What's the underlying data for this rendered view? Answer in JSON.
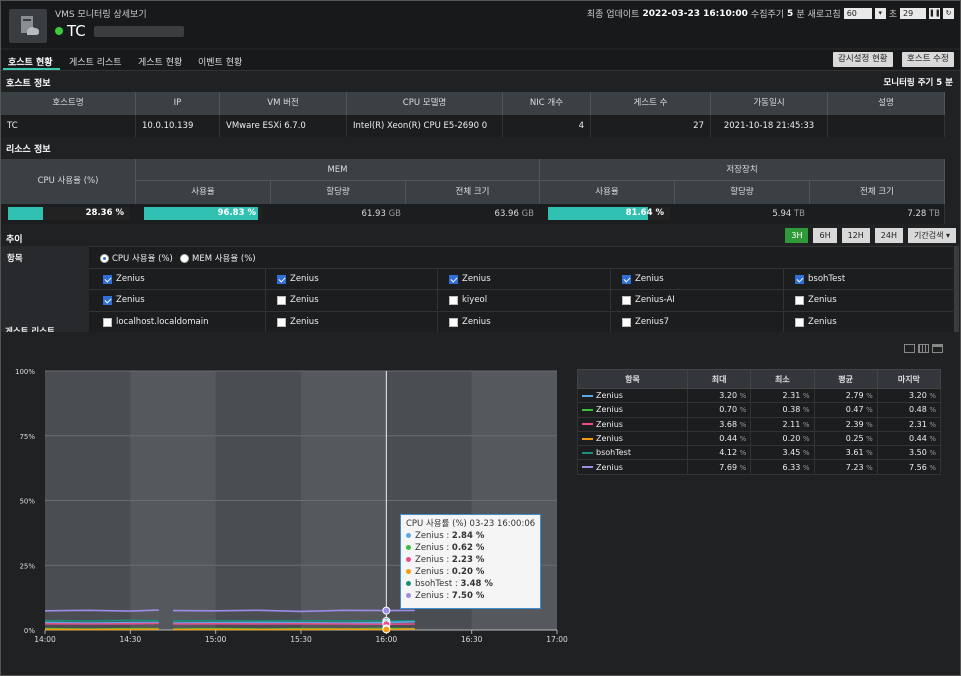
{
  "header": {
    "subtitle": "VMS 모니터링 상세보기",
    "title": "TC",
    "last_update_label": "최종 업데이트",
    "last_update": "2022-03-23 16:10:00",
    "cycle_label": "수집주기",
    "cycle_value": "5",
    "cycle_unit": "분",
    "refresh_label": "새로고침",
    "refresh_value": "60",
    "sec_label": "초",
    "countdown": "29"
  },
  "tabs": [
    "호스트 현황",
    "게스트 리스트",
    "게스트 현황",
    "이벤트 현황"
  ],
  "buttons": {
    "monitor_settings": "감시설정 현황",
    "edit_host": "호스트 수정"
  },
  "host_info": {
    "title": "호스트 정보",
    "cycle_text": "모니터링 주기 5 분",
    "columns": [
      "호스트명",
      "IP",
      "VM 버전",
      "CPU 모델명",
      "NIC 개수",
      "게스트 수",
      "가동일시",
      "설명"
    ],
    "row": [
      "TC",
      "10.0.10.139",
      "VMware ESXi 6.7.0",
      "Intel(R) Xeon(R) CPU E5-2690 0",
      "4",
      "27",
      "2021-10-18 21:45:33",
      ""
    ]
  },
  "resource": {
    "title": "리소스 정보",
    "cpu_header": "CPU 사용율 (%)",
    "mem_header": "MEM",
    "storage_header": "저장장치",
    "sub_headers": [
      "사용율",
      "할당량",
      "전체 크기",
      "사용율",
      "할당량",
      "전체 크기"
    ],
    "cpu_pct": 28.36,
    "cpu_text": "28.36 %",
    "mem_pct": 96.83,
    "mem_text": "96.83 %",
    "mem_alloc": "61.93",
    "mem_alloc_unit": "GB",
    "mem_total": "63.96",
    "mem_total_unit": "GB",
    "storage_pct": 81.64,
    "storage_text": "81.64 %",
    "storage_alloc": "5.94",
    "storage_alloc_unit": "TB",
    "storage_total": "7.28",
    "storage_total_unit": "TB"
  },
  "trend": {
    "title": "추이",
    "periods": [
      "3H",
      "6H",
      "12H",
      "24H"
    ],
    "active_period": "3H",
    "search_label": "기간검색 ▾",
    "item_label": "항목",
    "radio_cpu": "CPU 사용율 (%)",
    "radio_mem": "MEM 사용율 (%)",
    "guest_list_label": "게스트 리스트",
    "guests": [
      {
        "name": "Zenius",
        "checked": true
      },
      {
        "name": "Zenius",
        "checked": true
      },
      {
        "name": "Zenius",
        "checked": true
      },
      {
        "name": "Zenius",
        "checked": true
      },
      {
        "name": "bsohTest",
        "checked": true
      },
      {
        "name": "Zenius",
        "checked": true
      },
      {
        "name": "Zenius",
        "checked": false
      },
      {
        "name": "kiyeol",
        "checked": false
      },
      {
        "name": "Zenius-AI",
        "checked": false
      },
      {
        "name": "Zenius",
        "checked": false
      },
      {
        "name": "localhost.localdomain",
        "checked": false
      },
      {
        "name": "Zenius",
        "checked": false
      },
      {
        "name": "Zenius",
        "checked": false
      },
      {
        "name": "Zenius7",
        "checked": false
      },
      {
        "name": "Zenius",
        "checked": false
      }
    ]
  },
  "stats_table": {
    "columns": [
      "항목",
      "최대",
      "최소",
      "평균",
      "마지막"
    ],
    "unit": "%",
    "rows": [
      {
        "name": "Zenius",
        "color": "#5aa9e6",
        "max": "3.20",
        "min": "2.31",
        "avg": "2.79",
        "last": "3.20"
      },
      {
        "name": "Zenius",
        "color": "#3cbf3c",
        "max": "0.70",
        "min": "0.38",
        "avg": "0.47",
        "last": "0.48"
      },
      {
        "name": "Zenius",
        "color": "#e84c8b",
        "max": "3.68",
        "min": "2.11",
        "avg": "2.39",
        "last": "2.31"
      },
      {
        "name": "Zenius",
        "color": "#f39c12",
        "max": "0.44",
        "min": "0.20",
        "avg": "0.25",
        "last": "0.44"
      },
      {
        "name": "bsohTest",
        "color": "#1a8f7a",
        "max": "4.12",
        "min": "3.45",
        "avg": "3.61",
        "last": "3.50"
      },
      {
        "name": "Zenius",
        "color": "#9b8ce6",
        "max": "7.69",
        "min": "6.33",
        "avg": "7.23",
        "last": "7.56"
      }
    ]
  },
  "chart_data": {
    "type": "line",
    "title": "",
    "xlabel": "",
    "ylabel": "",
    "x_ticks": [
      "14:00",
      "14:30",
      "15:00",
      "15:30",
      "16:00",
      "16:30",
      "17:00"
    ],
    "y_ticks": [
      "0%",
      "25%",
      "50%",
      "75%",
      "100%"
    ],
    "ylim": [
      0,
      100
    ],
    "x": [
      "14:00",
      "14:15",
      "14:30",
      "14:40",
      "14:45",
      "15:00",
      "15:15",
      "15:30",
      "15:45",
      "16:00",
      "16:10"
    ],
    "gap_after_index": 3,
    "series": [
      {
        "color": "#9b8ce6",
        "values": [
          7.4,
          7.6,
          7.3,
          7.7,
          7.5,
          7.4,
          7.6,
          7.2,
          7.6,
          7.5,
          7.56
        ]
      },
      {
        "color": "#1a8f7a",
        "values": [
          3.6,
          3.5,
          3.7,
          3.6,
          3.5,
          3.6,
          3.5,
          3.6,
          3.5,
          3.48,
          3.5
        ]
      },
      {
        "color": "#5aa9e6",
        "values": [
          2.9,
          2.7,
          2.8,
          2.9,
          2.7,
          2.8,
          2.9,
          2.8,
          2.7,
          2.84,
          3.2
        ]
      },
      {
        "color": "#e84c8b",
        "values": [
          2.4,
          2.3,
          2.4,
          2.5,
          2.3,
          2.4,
          2.3,
          2.4,
          2.3,
          2.23,
          2.31
        ]
      },
      {
        "color": "#3cbf3c",
        "values": [
          0.5,
          0.4,
          0.5,
          0.5,
          0.4,
          0.5,
          0.4,
          0.5,
          0.4,
          0.62,
          0.48
        ]
      },
      {
        "color": "#f39c12",
        "values": [
          0.25,
          0.2,
          0.25,
          0.3,
          0.2,
          0.25,
          0.2,
          0.25,
          0.3,
          0.2,
          0.44
        ]
      }
    ],
    "tooltip": {
      "header": "CPU 사용률 (%) 03-23 16:00:06",
      "items": [
        {
          "name": "Zenius",
          "value": "2.84 %",
          "color": "#5aa9e6"
        },
        {
          "name": "Zenius",
          "value": "0.62 %",
          "color": "#3cbf3c"
        },
        {
          "name": "Zenius",
          "value": "2.23 %",
          "color": "#e84c8b"
        },
        {
          "name": "Zenius",
          "value": "0.20 %",
          "color": "#f39c12"
        },
        {
          "name": "bsohTest",
          "value": "3.48 %",
          "color": "#1a8f7a"
        },
        {
          "name": "Zenius",
          "value": "7.50 %",
          "color": "#9b8ce6"
        }
      ]
    }
  }
}
